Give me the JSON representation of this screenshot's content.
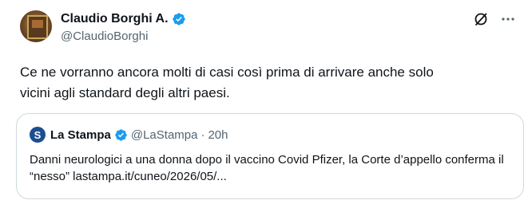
{
  "author": {
    "display_name": "Claudio Borghi A.",
    "handle": "@ClaudioBorghi",
    "avatar_icon": "avatar-image",
    "verified_color": "#1d9bf0"
  },
  "actions": {
    "grok_icon": "slash-circle-icon",
    "more_icon": "more-dots-icon"
  },
  "tweet": {
    "text": "Ce ne vorranno ancora molti di casi così prima di arrivare anche solo\nvicini agli standard degli altri paesi."
  },
  "quoted": {
    "logo_letter": "S",
    "display_name": "La Stampa",
    "handle": "@LaStampa",
    "separator": "·",
    "time": "20h",
    "verified_color": "#1d9bf0",
    "text": "Danni neurologici a una donna dopo il vaccino Covid Pfizer, la Corte d’appello conferma il “nesso” lastampa.it/cuneo/2026/05/..."
  }
}
